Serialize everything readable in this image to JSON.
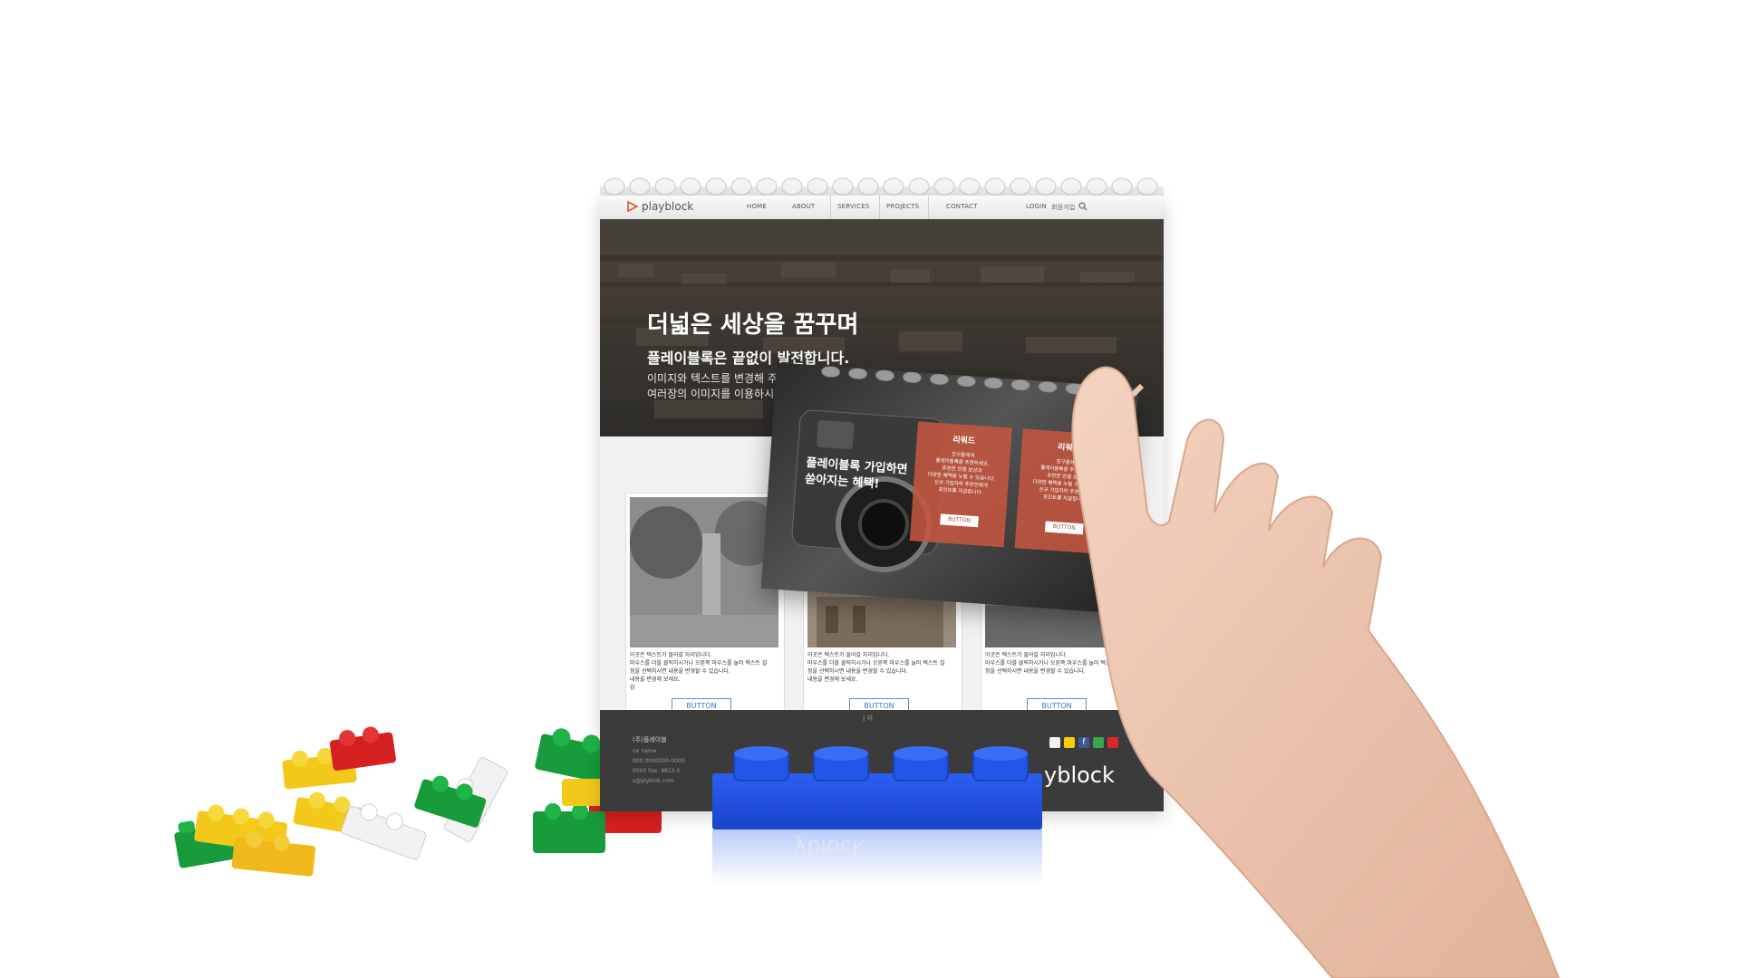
{
  "site": {
    "logo": "playblock",
    "nav": {
      "items": [
        "HOME",
        "ABOUT",
        "SERVICES",
        "PROJECTS",
        "CONTACT"
      ],
      "login": "LOGIN",
      "signup": "회원가입"
    },
    "hero": {
      "title": "더넓은 세상을 꿈꾸며",
      "subtitle": "플레이블록은 끝없이 발전합니다.",
      "body_line1": "이미지와 텍스트를 변경해 주세요.",
      "body_line2": "여러장의 이미지를 이용하시면 ."
    },
    "cards": [
      {
        "line1": "이곳은 텍스트가 들어갈 자리입니다.",
        "line2": "마우스를 더블 클릭하시거나 오른쪽 마우스를 눌러 텍스트 설",
        "line3": "정을 선택하시면 내용을 변경할 수 있습니다.",
        "line4": "내용을 변경해 보세요.",
        "line5": "감",
        "button": "BUTTON"
      },
      {
        "line1": "이곳은 텍스트가 들어갈 자리입니다.",
        "line2": "마우스를 더블 클릭하시거나 오른쪽 마우스를 눌러 텍스트 설",
        "line3": "정을 선택하시면 내용을 변경할 수 있습니다.",
        "line4": "내용을 변경해 보세요.",
        "line5": "",
        "button": "BUTTON"
      },
      {
        "line1": "이곳은 텍스트가 들어갈 자리입니다.",
        "line2": "마우스를 더블 클릭하시거나 오른쪽 마우스를 눌러 텍스트 설",
        "line3": "정을 선택하시면 내용을 변경할 수 있습니다.",
        "line4": "",
        "line5": "",
        "button": "BUTTON"
      }
    ],
    "footer": {
      "company": "(주)플레이블",
      "meta_line1": "ne name",
      "meta_line2": "000 0000000-0000",
      "meta_line3": "0000   Fax: 8813-0",
      "meta_line4": "s@plybiok.com",
      "mid_links": "| 이",
      "logo": "yblock"
    }
  },
  "popup": {
    "headline_line1": "플레이블록 가입하면",
    "headline_line2": "쏟아지는 혜택!",
    "rewards": [
      {
        "title": "리워드",
        "desc_line1": "친구들에게",
        "desc_line2": "플레이블록을 추천하세요.",
        "desc_line3": "추천한 만큼 보상과",
        "desc_line4": "다양한 혜택을 누릴 수 있습니다.",
        "desc_line5": "신규 가입자와 추천인에게",
        "desc_line6": "포인트를 지급합니다.",
        "button": "BUTTON"
      },
      {
        "title": "리워드",
        "desc_line1": "친구들에게",
        "desc_line2": "플레이블록을 추천하세요.",
        "desc_line3": "추천한 만큼 보상과",
        "desc_line4": "다양한 혜택을 누릴 수 있습니다.",
        "desc_line5": "신규 가입자와 추천인에게",
        "desc_line6": "포인트를 지급합니다.",
        "button": "BUTTON"
      }
    ]
  },
  "reflection": {
    "text": "yblock"
  },
  "colors": {
    "accent_blue": "#3a74c4",
    "reward_red": "#c45640",
    "footer_bg": "#3b3b3b",
    "brick_blue": "#1f4fe0"
  },
  "icons": [
    "playblock-logo-icon",
    "search-icon",
    "facebook-icon",
    "youtube-icon",
    "kakao-icon"
  ]
}
